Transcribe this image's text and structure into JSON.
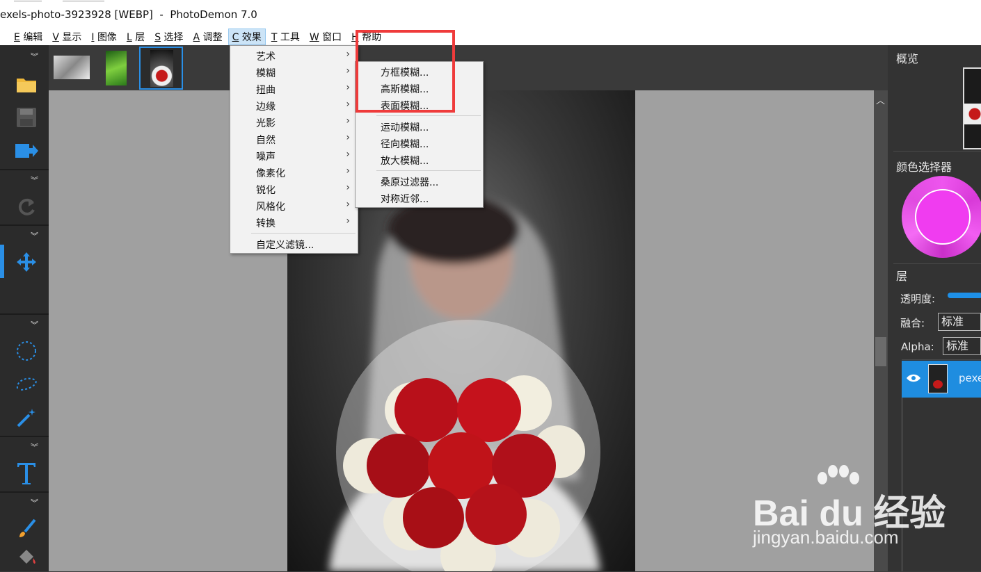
{
  "window": {
    "title": "exels-photo-3923928 [WEBP]  -  PhotoDemon 7.0"
  },
  "menubar": {
    "items": [
      {
        "key": "E",
        "label": "编辑"
      },
      {
        "key": "V",
        "label": "显示"
      },
      {
        "key": "I",
        "label": "图像"
      },
      {
        "key": "L",
        "label": "层"
      },
      {
        "key": "S",
        "label": "选择"
      },
      {
        "key": "A",
        "label": "调整"
      },
      {
        "key": "C",
        "label": "效果"
      },
      {
        "key": "T",
        "label": "工具"
      },
      {
        "key": "W",
        "label": "窗口"
      },
      {
        "key": "H",
        "label": "帮助"
      }
    ],
    "active": "效果"
  },
  "effects_menu": {
    "items": [
      "艺术",
      "模糊",
      "扭曲",
      "边缘",
      "光影",
      "自然",
      "噪声",
      "像素化",
      "锐化",
      "风格化",
      "转换"
    ],
    "custom": "自定义滤镜...",
    "submenu_arrow": "›"
  },
  "blur_submenu": {
    "group1": [
      "方框模糊...",
      "高斯模糊...",
      "表面模糊..."
    ],
    "group2": [
      "运动模糊...",
      "径向模糊...",
      "放大模糊..."
    ],
    "group3": [
      "桑原过滤器...",
      "对称近邻..."
    ]
  },
  "right_panel": {
    "overview_title": "概览",
    "color_picker_title": "颜色选择器",
    "color": "#f03cf0",
    "layers_title": "层",
    "opacity_label": "透明度:",
    "blend_label": "融合:",
    "blend_value": "标准",
    "alpha_label": "Alpha:",
    "alpha_value": "标准",
    "layer_name": "pexe"
  },
  "colors": {
    "accent": "#1f8de0",
    "highlight_box": "#ef3b3b"
  },
  "watermark": {
    "main": "Bai du 经验",
    "sub": "jingyan.baidu.com"
  }
}
